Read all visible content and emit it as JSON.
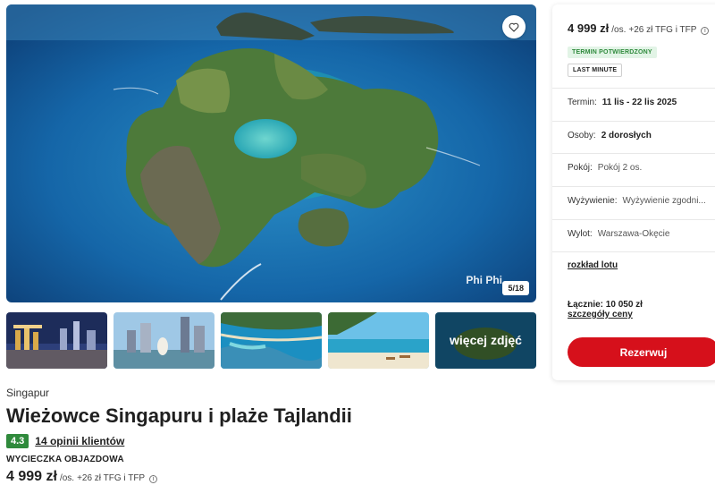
{
  "hero": {
    "caption": "Phi Phi",
    "photo_counter": "5/18"
  },
  "thumbnails": {
    "more_label": "więcej zdjęć"
  },
  "offer": {
    "country": "Singapur",
    "title": "Wieżowce Singapuru i plaże Tajlandii",
    "rating": "4.3",
    "reviews_link": "14 opinii klientów",
    "trip_type": "WYCIECZKA OBJAZDOWA",
    "price": "4 999 zł",
    "price_suffix": "/os.",
    "price_extra": "+26 zł TFG i TFP"
  },
  "booking_card": {
    "price": "4 999 zł",
    "price_suffix": "/os.",
    "price_extra": "+26 zł TFG i TFP",
    "tag_confirmed": "TERMIN POTWIERDZONY",
    "tag_last_minute": "LAST MINUTE",
    "term_label": "Termin:",
    "term_value": "11 lis - 22 lis 2025",
    "people_label": "Osoby:",
    "people_value": "2 dorosłych",
    "room_label": "Pokój:",
    "room_value": "Pokój 2 os.",
    "board_label": "Wyżywienie:",
    "board_value": "Wyżywienie zgodni...",
    "departure_label": "Wylot:",
    "departure_value": "Warszawa-Okęcie",
    "flight_schedule_link": "rozkład lotu",
    "total": "Łącznie: 10 050 zł",
    "price_details_link": "szczegóły ceny",
    "reserve_button": "Rezerwuj"
  },
  "colors": {
    "accent_red": "#d6101b",
    "rating_green": "#2f8a3c"
  },
  "icons": {
    "favorite": "heart-icon",
    "info": "info-icon",
    "expand": "chevron-down-icon"
  }
}
